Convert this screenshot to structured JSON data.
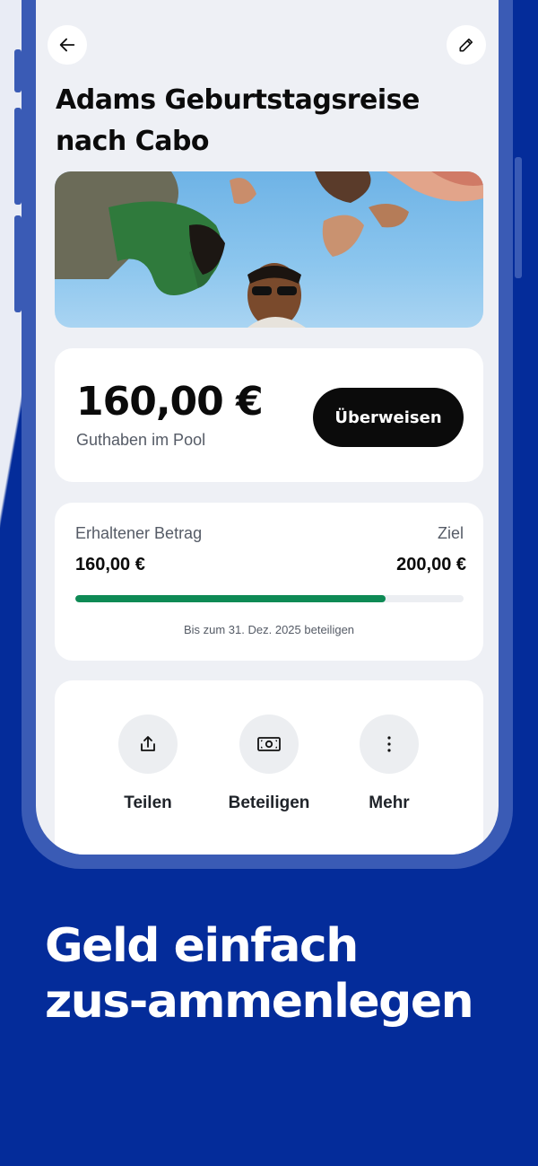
{
  "header": {
    "back_icon": "arrow-left-icon",
    "edit_icon": "pencil-icon"
  },
  "pool": {
    "title": "Adams Geburtstagsreise nach Cabo",
    "balance": "160,00 €",
    "balance_label": "Guthaben im Pool",
    "transfer_label": "Überweisen"
  },
  "progress": {
    "received_label": "Erhaltener Betrag",
    "received_value": "160,00 €",
    "goal_label": "Ziel",
    "goal_value": "200,00 €",
    "fraction": 0.8,
    "deadline": "Bis zum 31. Dez. 2025 beteiligen",
    "fill_color": "#0e8a55"
  },
  "actions": [
    {
      "label": "Teilen",
      "icon": "share-icon"
    },
    {
      "label": "Beteiligen",
      "icon": "cash-icon"
    },
    {
      "label": "Mehr",
      "icon": "more-vertical-icon"
    }
  ],
  "promo": {
    "line1": "Geld einfach",
    "line2": "zus-ammenlegen"
  },
  "colors": {
    "brand_blue": "#042c9a",
    "frame": "#3a5bb5"
  }
}
